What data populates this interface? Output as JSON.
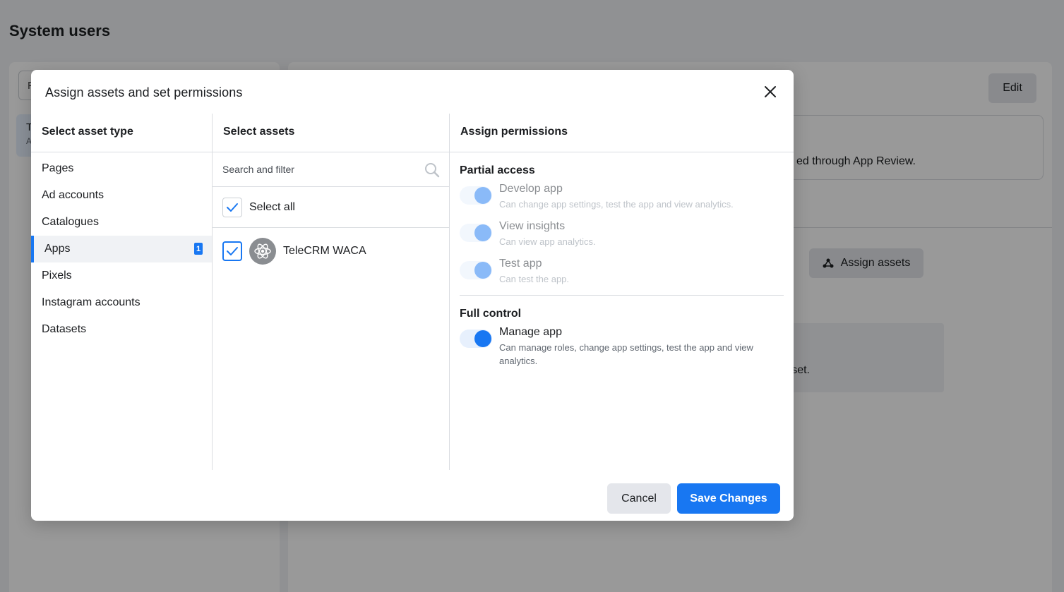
{
  "background": {
    "title": "System users",
    "left_search_placeholder": "F",
    "left_item_name": "T",
    "left_item_sub": "A",
    "edit_label": "Edit",
    "notice_text": "ed through App Review.",
    "assign_assets_label": "Assign assets",
    "info_text": "set."
  },
  "modal": {
    "title": "Assign assets and set permissions",
    "columns": {
      "asset_type": "Select asset type",
      "assets": "Select assets",
      "permissions": "Assign permissions"
    },
    "asset_types": [
      {
        "label": "Pages"
      },
      {
        "label": "Ad accounts"
      },
      {
        "label": "Catalogues"
      },
      {
        "label": "Apps",
        "badge": "1",
        "active": true
      },
      {
        "label": "Pixels"
      },
      {
        "label": "Instagram accounts"
      },
      {
        "label": "Datasets"
      }
    ],
    "search_placeholder": "Search and filter",
    "select_all_label": "Select all",
    "assets": [
      {
        "name": "TeleCRM WACA",
        "checked": true,
        "icon": "app-atom-icon"
      }
    ],
    "partial_access": {
      "title": "Partial access",
      "items": [
        {
          "label": "Develop app",
          "desc": "Can change app settings, test the app and view analytics."
        },
        {
          "label": "View insights",
          "desc": "Can view app analytics."
        },
        {
          "label": "Test app",
          "desc": "Can test the app."
        }
      ]
    },
    "full_control": {
      "title": "Full control",
      "items": [
        {
          "label": "Manage app",
          "desc": "Can manage roles, change app settings, test the app and view analytics."
        }
      ]
    },
    "cancel_label": "Cancel",
    "save_label": "Save Changes"
  },
  "colors": {
    "accent": "#1877f2",
    "overlay": "rgba(0,0,0,0.4)"
  }
}
